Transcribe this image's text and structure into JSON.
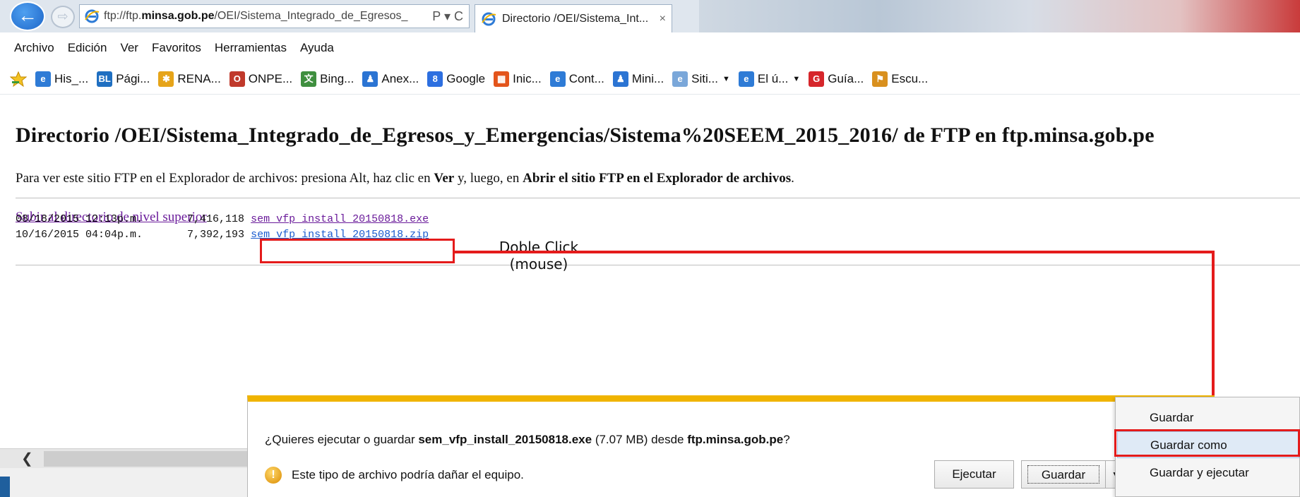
{
  "browser": {
    "address_url_prefix": "ftp://ftp.",
    "address_url_domain": "minsa.gob.pe",
    "address_url_path": "/OEI/Sistema_Integrado_de_Egresos_",
    "address_tools": "Ρ ▾ C",
    "tab_title": "Directorio /OEI/Sistema_Int...",
    "tab_close": "×",
    "back_glyph": "←",
    "forward_glyph": "⇨"
  },
  "menu": {
    "items": [
      "Archivo",
      "Edición",
      "Ver",
      "Favoritos",
      "Herramientas",
      "Ayuda"
    ]
  },
  "favorites": [
    {
      "label": "His_...",
      "icon": "ie-icon",
      "color": "#2e7bd6",
      "glyph": "e",
      "caret": ""
    },
    {
      "label": "Pági...",
      "icon": "bl-icon",
      "color": "#1f6fc1",
      "glyph": "BL",
      "caret": ""
    },
    {
      "label": "RENA...",
      "icon": "reniec-icon",
      "color": "#e6a419",
      "glyph": "✱",
      "caret": ""
    },
    {
      "label": "ONPE...",
      "icon": "onpe-icon",
      "color": "#c0392b",
      "glyph": "O",
      "caret": ""
    },
    {
      "label": "Bing...",
      "icon": "translate-icon",
      "color": "#3f8f3f",
      "glyph": "文",
      "caret": ""
    },
    {
      "label": "Anex...",
      "icon": "person-icon",
      "color": "#2b74d3",
      "glyph": "♟",
      "caret": ""
    },
    {
      "label": "Google",
      "icon": "google-icon",
      "color": "#2d6fe0",
      "glyph": "8",
      "caret": ""
    },
    {
      "label": "Inic...",
      "icon": "windows-icon",
      "color": "#e3541b",
      "glyph": "▦",
      "caret": ""
    },
    {
      "label": "Cont...",
      "icon": "ie-icon",
      "color": "#2e7bd6",
      "glyph": "e",
      "caret": ""
    },
    {
      "label": "Mini...",
      "icon": "person-icon",
      "color": "#2b74d3",
      "glyph": "♟",
      "caret": ""
    },
    {
      "label": "Siti...",
      "icon": "ie-icon",
      "color": "#7aa7d9",
      "glyph": "e",
      "caret": "▼"
    },
    {
      "label": "El ú...",
      "icon": "ie-icon",
      "color": "#2e7bd6",
      "glyph": "e",
      "caret": "▼"
    },
    {
      "label": "Guía...",
      "icon": "guia-icon",
      "color": "#d6262b",
      "glyph": "G",
      "caret": ""
    },
    {
      "label": "Escu...",
      "icon": "school-icon",
      "color": "#d9901e",
      "glyph": "⚑",
      "caret": ""
    }
  ],
  "page": {
    "title": "Directorio /OEI/Sistema_Integrado_de_Egresos_y_Emergencias/Sistema%20SEEM_2015_2016/ de FTP en ftp.minsa.gob.pe",
    "instr_1": "Para ver este sitio FTP en el Explorador de archivos: presiona Alt, haz clic en ",
    "instr_ver": "Ver",
    "instr_2": " y, luego, en ",
    "instr_open": "Abrir el sitio FTP en el Explorador de archivos",
    "instr_3": ".",
    "up_link": "Subir al directorio de nivel superior",
    "files": [
      {
        "date": "08/18/2015 12:13p.m.",
        "size": "7,416,118",
        "name": "sem vfp install 20150818.exe"
      },
      {
        "date": "10/16/2015 04:04p.m.",
        "size": "7,392,193",
        "name": "sem vfp install 20150818.zip"
      }
    ],
    "callout_line1": "Doble Click",
    "callout_line2": "(mouse)"
  },
  "download_bar": {
    "q_1": "¿Quieres ejecutar o guardar ",
    "q_file": "sem_vfp_install_20150818.exe",
    "q_2": " (7.07 MB) desde ",
    "q_host": "ftp.minsa.gob.pe",
    "q_3": "?",
    "warning": "Este tipo de archivo podría dañar el equipo.",
    "run_label": "Ejecutar",
    "save_label": "Guardar",
    "arrow": "▼"
  },
  "save_menu": {
    "items": [
      "Guardar",
      "Guardar como",
      "Guardar y ejecutar"
    ],
    "highlighted": "Guardar como"
  },
  "annotation_color": "#e41b1b",
  "scrollbar_arrow": "❮"
}
